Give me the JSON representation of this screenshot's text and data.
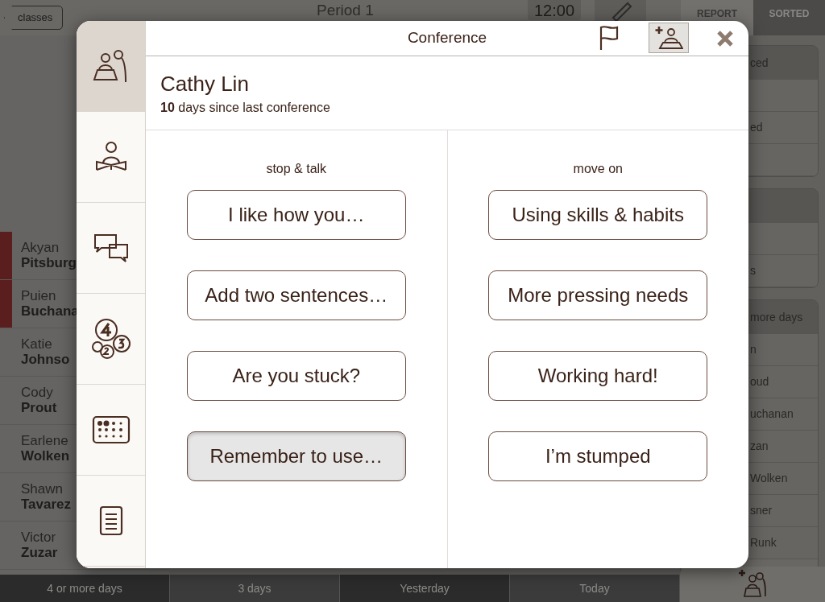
{
  "top_bar": {
    "back": "classes",
    "title": "Period 1",
    "time": "12:00",
    "report": "REPORT",
    "sorted": "SORTED"
  },
  "students": [
    {
      "first": "Akyan",
      "last": "Pitsburg",
      "color": "#5a1e1e"
    },
    {
      "first": "Puien",
      "last": "Buchana",
      "color": "#5a1e1e"
    },
    {
      "first": "Katie",
      "last": "Johnso"
    },
    {
      "first": "Cody",
      "last": "Prout"
    },
    {
      "first": "Earlene",
      "last": "Wolken"
    },
    {
      "first": "Shawn",
      "last": "Tavarez"
    },
    {
      "first": "Victor",
      "last": "Zuzar"
    }
  ],
  "right_panels": [
    {
      "header": "ced",
      "rows": [
        "",
        "ed",
        ""
      ]
    },
    {
      "rows": [
        "",
        "s"
      ]
    },
    {
      "header": "more days",
      "rows": [
        "n",
        "oud",
        "uchanan",
        "zan",
        "Wolken",
        "sner",
        "Runk"
      ]
    }
  ],
  "bottom_tabs": [
    "4 or more days",
    "3 days",
    "Yesterday",
    "Today"
  ],
  "dialog": {
    "title": "Conference",
    "header_buttons": [
      {
        "kind": "flag",
        "selected": false
      },
      {
        "kind": "add-person",
        "selected": true
      }
    ],
    "sidebar": [
      {
        "kind": "conference",
        "selected": true
      },
      {
        "kind": "reader",
        "selected": false
      },
      {
        "kind": "chat",
        "selected": false
      },
      {
        "kind": "numbers",
        "selected": false
      },
      {
        "kind": "dots",
        "selected": false
      },
      {
        "kind": "notes",
        "selected": false
      }
    ],
    "student": "Cathy Lin",
    "since": "**10** days since last conference",
    "columns": [
      {
        "heading": "stop & talk",
        "buttons": [
          {
            "label": "I like how you…",
            "selected": false
          },
          {
            "label": "Add two sentences…",
            "selected": false
          },
          {
            "label": "Are you stuck?",
            "selected": false
          },
          {
            "label": "Remember to use…",
            "selected": true
          }
        ]
      },
      {
        "heading": "move on",
        "buttons": [
          {
            "label": "Using skills & habits",
            "selected": false
          },
          {
            "label": "More pressing needs",
            "selected": false
          },
          {
            "label": "Working hard!",
            "selected": false
          },
          {
            "label": "I’m stumped",
            "selected": false
          }
        ]
      }
    ]
  }
}
